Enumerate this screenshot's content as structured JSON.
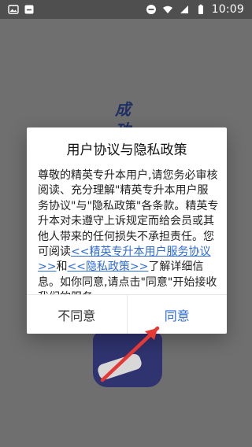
{
  "statusbar": {
    "time": "10:09",
    "left_icons": [
      "image-icon",
      "app-icon"
    ],
    "right_icons": [
      "dnd-icon",
      "wifi-icon",
      "signal-icon",
      "battery-icon"
    ]
  },
  "background": {
    "text": "成功改"
  },
  "dialog": {
    "title": "用户协议与隐私政策",
    "body_intro": "尊敬的精英专升本用户,请您务必审核阅读、充分理解\"精英专升本用户服务协议\"与\"隐私政策\"各条款。精英专升本对未遵守上诉规定而给会员或其他人带来的任何损失不承担责任。您可阅读",
    "link_agreement": "<<精英专升本用户服务协议>>",
    "and": "和",
    "link_privacy": "<<隐私政策>>",
    "body_outro": "了解详细信息。如你同意,请点击\"同意\"开始接收我们的服务",
    "buttons": {
      "disagree": "不同意",
      "agree": "同意"
    }
  },
  "colors": {
    "accent": "#2f6bd8",
    "annotation": "#e53935",
    "background_text": "#1e2f63"
  }
}
